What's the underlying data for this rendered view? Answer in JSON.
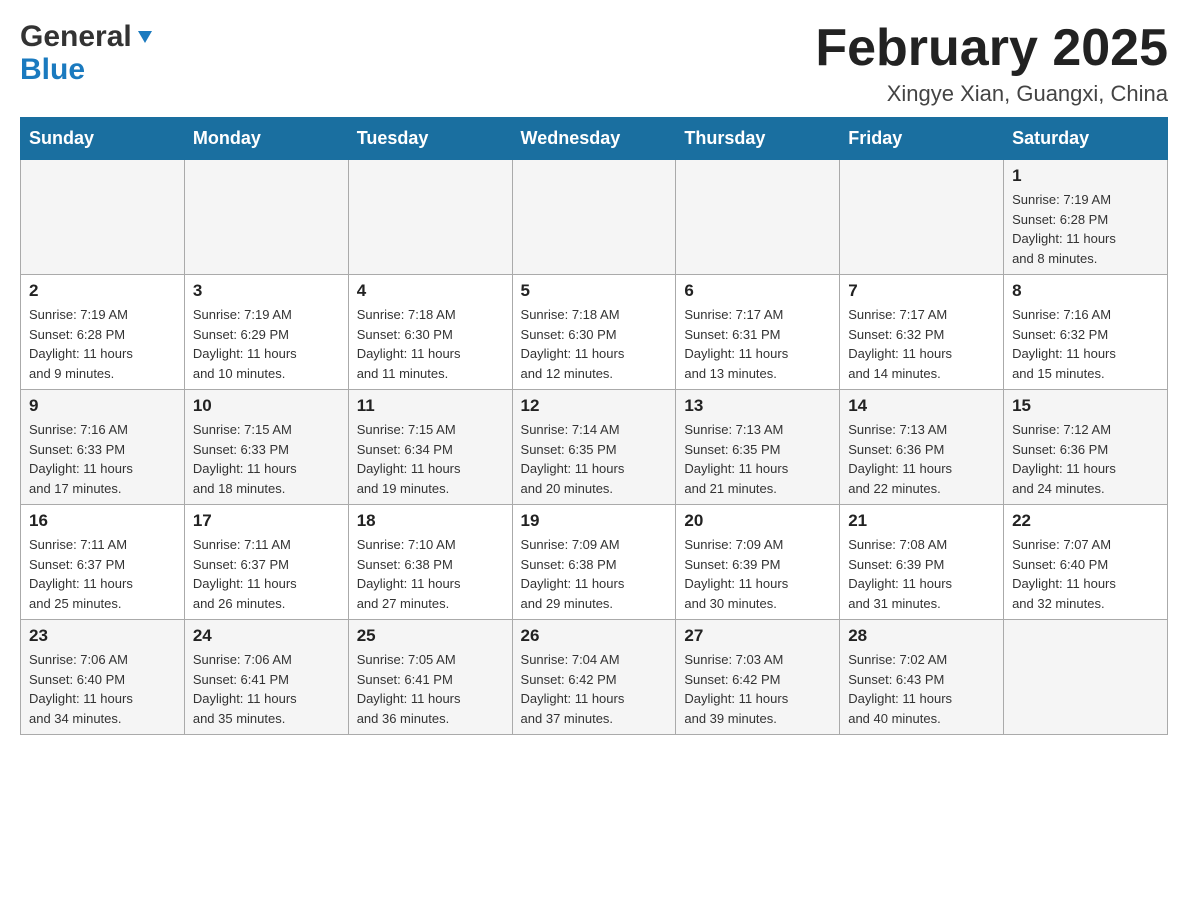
{
  "header": {
    "logo_general": "General",
    "logo_blue": "Blue",
    "month_title": "February 2025",
    "location": "Xingye Xian, Guangxi, China"
  },
  "days_of_week": [
    "Sunday",
    "Monday",
    "Tuesday",
    "Wednesday",
    "Thursday",
    "Friday",
    "Saturday"
  ],
  "weeks": [
    {
      "days": [
        {
          "num": "",
          "info": ""
        },
        {
          "num": "",
          "info": ""
        },
        {
          "num": "",
          "info": ""
        },
        {
          "num": "",
          "info": ""
        },
        {
          "num": "",
          "info": ""
        },
        {
          "num": "",
          "info": ""
        },
        {
          "num": "1",
          "info": "Sunrise: 7:19 AM\nSunset: 6:28 PM\nDaylight: 11 hours\nand 8 minutes."
        }
      ]
    },
    {
      "days": [
        {
          "num": "2",
          "info": "Sunrise: 7:19 AM\nSunset: 6:28 PM\nDaylight: 11 hours\nand 9 minutes."
        },
        {
          "num": "3",
          "info": "Sunrise: 7:19 AM\nSunset: 6:29 PM\nDaylight: 11 hours\nand 10 minutes."
        },
        {
          "num": "4",
          "info": "Sunrise: 7:18 AM\nSunset: 6:30 PM\nDaylight: 11 hours\nand 11 minutes."
        },
        {
          "num": "5",
          "info": "Sunrise: 7:18 AM\nSunset: 6:30 PM\nDaylight: 11 hours\nand 12 minutes."
        },
        {
          "num": "6",
          "info": "Sunrise: 7:17 AM\nSunset: 6:31 PM\nDaylight: 11 hours\nand 13 minutes."
        },
        {
          "num": "7",
          "info": "Sunrise: 7:17 AM\nSunset: 6:32 PM\nDaylight: 11 hours\nand 14 minutes."
        },
        {
          "num": "8",
          "info": "Sunrise: 7:16 AM\nSunset: 6:32 PM\nDaylight: 11 hours\nand 15 minutes."
        }
      ]
    },
    {
      "days": [
        {
          "num": "9",
          "info": "Sunrise: 7:16 AM\nSunset: 6:33 PM\nDaylight: 11 hours\nand 17 minutes."
        },
        {
          "num": "10",
          "info": "Sunrise: 7:15 AM\nSunset: 6:33 PM\nDaylight: 11 hours\nand 18 minutes."
        },
        {
          "num": "11",
          "info": "Sunrise: 7:15 AM\nSunset: 6:34 PM\nDaylight: 11 hours\nand 19 minutes."
        },
        {
          "num": "12",
          "info": "Sunrise: 7:14 AM\nSunset: 6:35 PM\nDaylight: 11 hours\nand 20 minutes."
        },
        {
          "num": "13",
          "info": "Sunrise: 7:13 AM\nSunset: 6:35 PM\nDaylight: 11 hours\nand 21 minutes."
        },
        {
          "num": "14",
          "info": "Sunrise: 7:13 AM\nSunset: 6:36 PM\nDaylight: 11 hours\nand 22 minutes."
        },
        {
          "num": "15",
          "info": "Sunrise: 7:12 AM\nSunset: 6:36 PM\nDaylight: 11 hours\nand 24 minutes."
        }
      ]
    },
    {
      "days": [
        {
          "num": "16",
          "info": "Sunrise: 7:11 AM\nSunset: 6:37 PM\nDaylight: 11 hours\nand 25 minutes."
        },
        {
          "num": "17",
          "info": "Sunrise: 7:11 AM\nSunset: 6:37 PM\nDaylight: 11 hours\nand 26 minutes."
        },
        {
          "num": "18",
          "info": "Sunrise: 7:10 AM\nSunset: 6:38 PM\nDaylight: 11 hours\nand 27 minutes."
        },
        {
          "num": "19",
          "info": "Sunrise: 7:09 AM\nSunset: 6:38 PM\nDaylight: 11 hours\nand 29 minutes."
        },
        {
          "num": "20",
          "info": "Sunrise: 7:09 AM\nSunset: 6:39 PM\nDaylight: 11 hours\nand 30 minutes."
        },
        {
          "num": "21",
          "info": "Sunrise: 7:08 AM\nSunset: 6:39 PM\nDaylight: 11 hours\nand 31 minutes."
        },
        {
          "num": "22",
          "info": "Sunrise: 7:07 AM\nSunset: 6:40 PM\nDaylight: 11 hours\nand 32 minutes."
        }
      ]
    },
    {
      "days": [
        {
          "num": "23",
          "info": "Sunrise: 7:06 AM\nSunset: 6:40 PM\nDaylight: 11 hours\nand 34 minutes."
        },
        {
          "num": "24",
          "info": "Sunrise: 7:06 AM\nSunset: 6:41 PM\nDaylight: 11 hours\nand 35 minutes."
        },
        {
          "num": "25",
          "info": "Sunrise: 7:05 AM\nSunset: 6:41 PM\nDaylight: 11 hours\nand 36 minutes."
        },
        {
          "num": "26",
          "info": "Sunrise: 7:04 AM\nSunset: 6:42 PM\nDaylight: 11 hours\nand 37 minutes."
        },
        {
          "num": "27",
          "info": "Sunrise: 7:03 AM\nSunset: 6:42 PM\nDaylight: 11 hours\nand 39 minutes."
        },
        {
          "num": "28",
          "info": "Sunrise: 7:02 AM\nSunset: 6:43 PM\nDaylight: 11 hours\nand 40 minutes."
        },
        {
          "num": "",
          "info": ""
        }
      ]
    }
  ]
}
